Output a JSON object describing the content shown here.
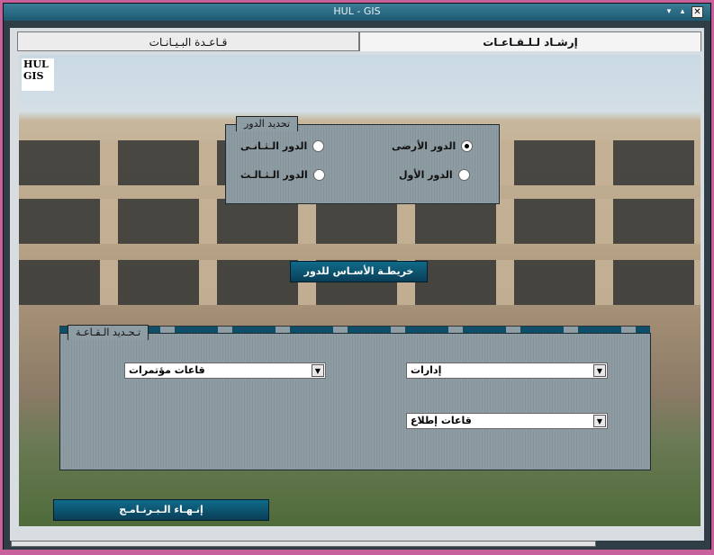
{
  "window": {
    "title": "HUL - GIS",
    "controls": {
      "down": "▾",
      "up": "▴",
      "close": "✕"
    }
  },
  "tabs": [
    {
      "label": "قـاعـدة البـيـانـات",
      "active": false
    },
    {
      "label": "إرشـاد لـلـقـاعـات",
      "active": true
    }
  ],
  "logo": {
    "line1": "HUL",
    "line2": "GIS"
  },
  "floor_panel": {
    "legend": "تحديد الدور",
    "options": [
      {
        "label": "الدور الأرضى",
        "checked": true
      },
      {
        "label": "الدور الـثـانـى",
        "checked": false
      },
      {
        "label": "الدور الأول",
        "checked": false
      },
      {
        "label": "الدور الـثـالـث",
        "checked": false
      }
    ]
  },
  "base_map_button": "خريطـة الأسـاس للدور",
  "hall_panel": {
    "legend": "تـحـديد الـقـاعـة",
    "selects": [
      {
        "value": "إدارات"
      },
      {
        "value": "قاعات مؤتمرات"
      },
      {
        "value": "قاعات إطلاع"
      }
    ]
  },
  "exit_button": "إنـهـاء الـبـرنـامـج",
  "colors": {
    "window_border": "#c8609c",
    "button_fill": "#0a3e57",
    "panel_fill": "#8e9ca3"
  }
}
